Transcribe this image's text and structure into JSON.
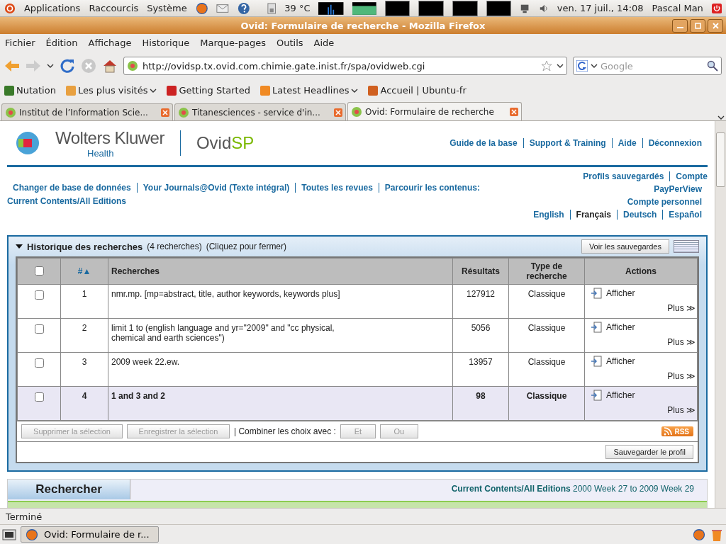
{
  "desktop_panel": {
    "menus": [
      "Applications",
      "Raccourcis",
      "Système"
    ],
    "temperature": "39 °C",
    "clock": "ven. 17 juil., 14:08",
    "user": "Pascal Man"
  },
  "window": {
    "title": "Ovid: Formulaire de recherche - Mozilla Firefox"
  },
  "menubar": [
    "Fichier",
    "Édition",
    "Affichage",
    "Historique",
    "Marque-pages",
    "Outils",
    "Aide"
  ],
  "navigation": {
    "url": "http://ovidsp.tx.ovid.com.chimie.gate.inist.fr/spa/ovidweb.cgi",
    "search_placeholder": "Google"
  },
  "bookmarks": [
    {
      "label": "Nutation",
      "has_menu": false
    },
    {
      "label": "Les plus visités",
      "has_menu": true
    },
    {
      "label": "Getting Started",
      "has_menu": false
    },
    {
      "label": "Latest Headlines",
      "has_menu": true
    },
    {
      "label": "Accueil | Ubuntu-fr",
      "has_menu": false
    }
  ],
  "tabs": [
    {
      "label": "Institut de l’Information Scie...",
      "selected": false
    },
    {
      "label": "Titanesciences - service d'in...",
      "selected": false
    },
    {
      "label": "Ovid: Formulaire de recherche",
      "selected": true
    }
  ],
  "page": {
    "logo": {
      "brand": "Wolters Kluwer",
      "sub": "Health",
      "product": "Ovid",
      "product_accent": "SP"
    },
    "top_links": [
      "Guide de la base",
      "Support & Training",
      "Aide",
      "Déconnexion"
    ],
    "nav_links": [
      "Changer de base de données",
      "Your Journals@Ovid (Texte intégral)",
      "Toutes les revues",
      "Parcourir les contenus:"
    ],
    "nav_extra": "Current Contents/All Editions",
    "account_links": [
      "Profils sauvegardés",
      "Compte"
    ],
    "account_more": [
      "PayPerView",
      "Compte personnel"
    ],
    "languages": [
      {
        "label": "English",
        "selected": false
      },
      {
        "label": "Français",
        "selected": true
      },
      {
        "label": "Deutsch",
        "selected": false
      },
      {
        "label": "Español",
        "selected": false
      }
    ],
    "history": {
      "title": "Historique des recherches",
      "count": "(4 recherches)",
      "hint": "(Cliquez pour fermer)",
      "expanded": true,
      "saved_button": "Voir les sauvegardes",
      "columns": [
        {
          "label": "#",
          "sort_mark": "▲"
        },
        {
          "label": "Recherches"
        },
        {
          "label": "Résultats"
        },
        {
          "label": "Type de recherche"
        },
        {
          "label": "Actions"
        }
      ],
      "all_checked": false,
      "rows": [
        {
          "checked": false,
          "selected": false,
          "number": "1",
          "query": "nmr.mp. [mp=abstract, title, author keywords, keywords plus]",
          "results": "127912",
          "type": "Classique",
          "action": "Afficher",
          "more": "Plus ≫"
        },
        {
          "checked": false,
          "selected": false,
          "number": "2",
          "query": "limit 1 to (english language and yr=\"2009\" and \"cc physical, chemical and earth sciences\")",
          "results": "5056",
          "type": "Classique",
          "action": "Afficher",
          "more": "Plus ≫"
        },
        {
          "checked": false,
          "selected": false,
          "number": "3",
          "query": "2009 week 22.ew.",
          "results": "13957",
          "type": "Classique",
          "action": "Afficher",
          "more": "Plus ≫"
        },
        {
          "checked": false,
          "selected": true,
          "number": "4",
          "query": "1 and 3 and 2",
          "results": "98",
          "type": "Classique",
          "action": "Afficher",
          "more": "Plus ≫"
        }
      ],
      "footer_buttons": [
        {
          "label": "Supprimer la sélection",
          "disabled": true
        },
        {
          "label": "Enregistrer la sélection",
          "disabled": true
        }
      ],
      "combine_label": "| Combiner les choix avec :",
      "combine_buttons": [
        {
          "label": "Et",
          "disabled": true
        },
        {
          "label": "Ou",
          "disabled": true
        }
      ],
      "rss": "RSS",
      "save_profile": "Sauvegarder le profil"
    },
    "search": {
      "tab": "Rechercher",
      "database": "Current Contents/All Editions",
      "range": "2000 Week 27 to 2009 Week 29"
    }
  },
  "status_bar": "Terminé",
  "taskbar": [
    {
      "label": "Ovid: Formulaire de r..."
    }
  ]
}
